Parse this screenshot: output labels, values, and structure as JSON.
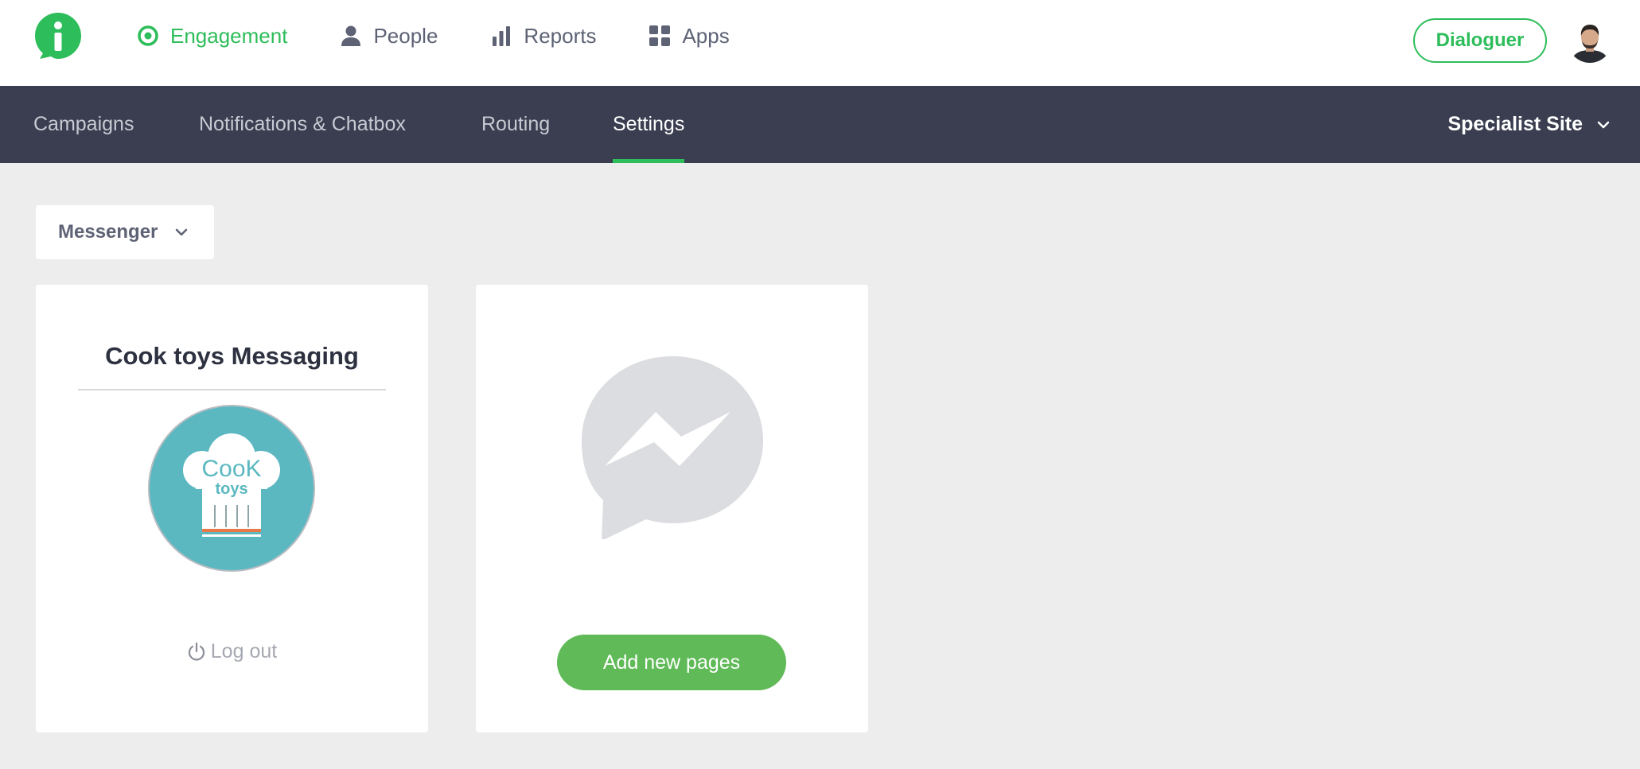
{
  "brand": {
    "logo_icon": "info-logo-icon",
    "accent": "#2dbd5a",
    "dark_bar": "#3a3e50"
  },
  "nav": {
    "items": [
      {
        "label": "Engagement",
        "icon": "target-icon",
        "active": true
      },
      {
        "label": "People",
        "icon": "person-icon",
        "active": false
      },
      {
        "label": "Reports",
        "icon": "bar-chart-icon",
        "active": false
      },
      {
        "label": "Apps",
        "icon": "grid-icon",
        "active": false
      }
    ],
    "cta_label": "Dialoguer"
  },
  "subnav": {
    "tabs": [
      {
        "label": "Campaigns",
        "active": false
      },
      {
        "label": "Notifications & Chatbox",
        "active": false
      },
      {
        "label": "Routing",
        "active": false
      },
      {
        "label": "Settings",
        "active": true
      }
    ],
    "site_selector": {
      "value": "Specialist Site"
    }
  },
  "main": {
    "channel_select": {
      "value": "Messenger"
    },
    "cards": [
      {
        "title": "Cook toys Messaging",
        "logo_text_line1": "CooK",
        "logo_text_line2": "toys",
        "logout_label": "Log out"
      },
      {
        "icon": "messenger-icon",
        "button_label": "Add new pages"
      }
    ]
  }
}
